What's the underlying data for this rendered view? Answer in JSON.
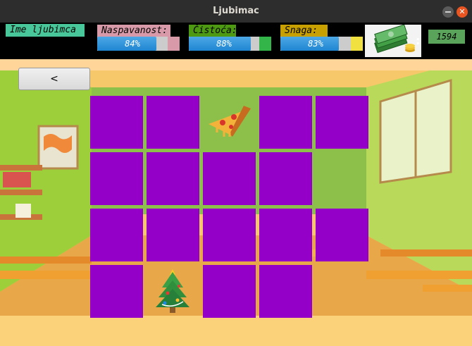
{
  "window": {
    "title": "Ljubimac"
  },
  "pet": {
    "name": "Ime ljubimca"
  },
  "stats": {
    "sleepiness": {
      "label": "Naspavanost:",
      "value": "84%",
      "fraction": 0.84,
      "cap_color": "#d89aa9"
    },
    "cleanliness": {
      "label": "Čistoća:",
      "value": "88%",
      "fraction": 0.88,
      "cap_color": "#33b54a"
    },
    "strength": {
      "label": "Snaga:",
      "value": "83%",
      "fraction": 0.83,
      "cap_color": "#f0e040"
    }
  },
  "money": {
    "value": "1594",
    "icon": "money-stack-icon"
  },
  "nav": {
    "back_label": "<"
  },
  "game": {
    "rows": 4,
    "cols": 5,
    "tile_color": "#9400c8",
    "revealed": [
      {
        "row": 0,
        "col": 2,
        "icon": "pizza-slice-icon"
      },
      {
        "row": 3,
        "col": 1,
        "icon": "christmas-tree-icon"
      }
    ],
    "hidden_positions": [
      [
        1,
        4
      ],
      [
        3,
        4
      ]
    ]
  },
  "colors": {
    "pet_name_bg": "#48c79a",
    "sleep_label_bg": "#d89aa9",
    "clean_label_bg": "#4d9a12",
    "strength_label_bg": "#c8a000",
    "money_bg": "#5aa35a",
    "titlebar": "#2d2d2d",
    "close": "#e95420"
  }
}
